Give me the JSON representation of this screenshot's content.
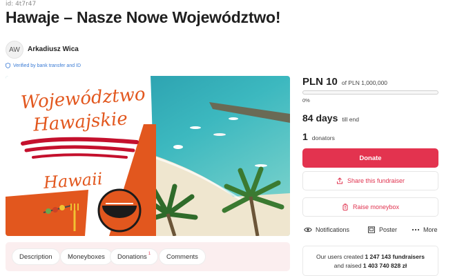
{
  "page": {
    "id_label": "id: 4t7r47",
    "title": "Hawaje – Nasze Nowe Województwo!"
  },
  "author": {
    "initials": "AW",
    "name": "Arkadiusz Wica",
    "verified_text": "Verified by bank transfer and ID"
  },
  "hero": {
    "line1": "Województwo",
    "line2": "Hawajskie",
    "line3": "Hawaii"
  },
  "tabs": [
    {
      "label": "Description"
    },
    {
      "label": "Moneyboxes"
    },
    {
      "label": "Donations",
      "badge": "1"
    },
    {
      "label": "Comments"
    }
  ],
  "fundraiser": {
    "amount": "PLN 10",
    "goal": "of PLN 1,000,000",
    "progress_percent_label": "0%",
    "progress_fraction": 1e-05,
    "days": "84 days",
    "days_suffix": "till end",
    "donators_count": "1",
    "donators_label": "donators"
  },
  "actions": {
    "donate": "Donate",
    "share": "Share this fundraiser",
    "moneybox": "Raise moneybox",
    "notifications": "Notifications",
    "poster": "Poster",
    "more": "More"
  },
  "stats": {
    "line1_prefix": "Our users created",
    "fundraisers_count": "1 247 143 fundraisers",
    "line2_prefix": "and raised",
    "raised_amount": "1 403 740 828 zł"
  },
  "colors": {
    "accent": "#e3334f",
    "card_orange": "#e2571e",
    "verified_blue": "#3a7bd5"
  },
  "icons": [
    "shield-check-icon",
    "share-icon",
    "moneybox-icon",
    "eye-icon",
    "poster-icon",
    "more-dots-icon"
  ]
}
